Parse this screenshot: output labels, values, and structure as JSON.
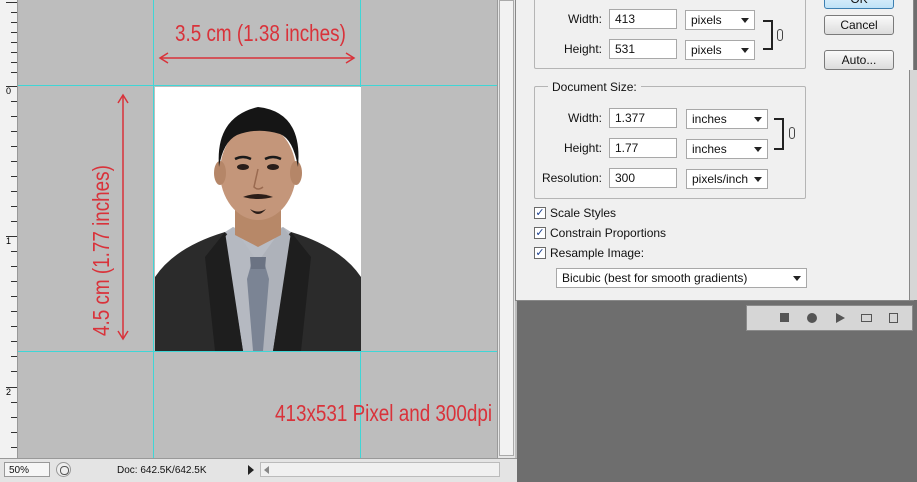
{
  "canvas": {
    "ruler_labels": [
      "0",
      "1",
      "2"
    ],
    "annotations": {
      "width_text": "3.5 cm (1.38 inches)",
      "height_text": "4.5 cm (1.77 inches)",
      "pixel_text": "413x531 Pixel and 300dpi"
    },
    "colors": {
      "guide": "#3fd6d6",
      "annotation": "#d9323a"
    }
  },
  "status_bar": {
    "zoom": "50%",
    "doc_info": "Doc: 642.5K/642.5K"
  },
  "dialog": {
    "pixel_dimensions": {
      "width_label": "Width:",
      "width_value": "413",
      "width_unit": "pixels",
      "height_label": "Height:",
      "height_value": "531",
      "height_unit": "pixels"
    },
    "document_size": {
      "title": "Document Size:",
      "width_label": "Width:",
      "width_value": "1.377",
      "width_unit": "inches",
      "height_label": "Height:",
      "height_value": "1.77",
      "height_unit": "inches",
      "resolution_label": "Resolution:",
      "resolution_value": "300",
      "resolution_unit": "pixels/inch"
    },
    "options": {
      "scale_styles": "Scale Styles",
      "constrain_proportions": "Constrain Proportions",
      "resample_image": "Resample Image:",
      "resample_method": "Bicubic (best for smooth gradients)"
    },
    "buttons": {
      "ok": "OK",
      "cancel": "Cancel",
      "auto": "Auto..."
    }
  }
}
